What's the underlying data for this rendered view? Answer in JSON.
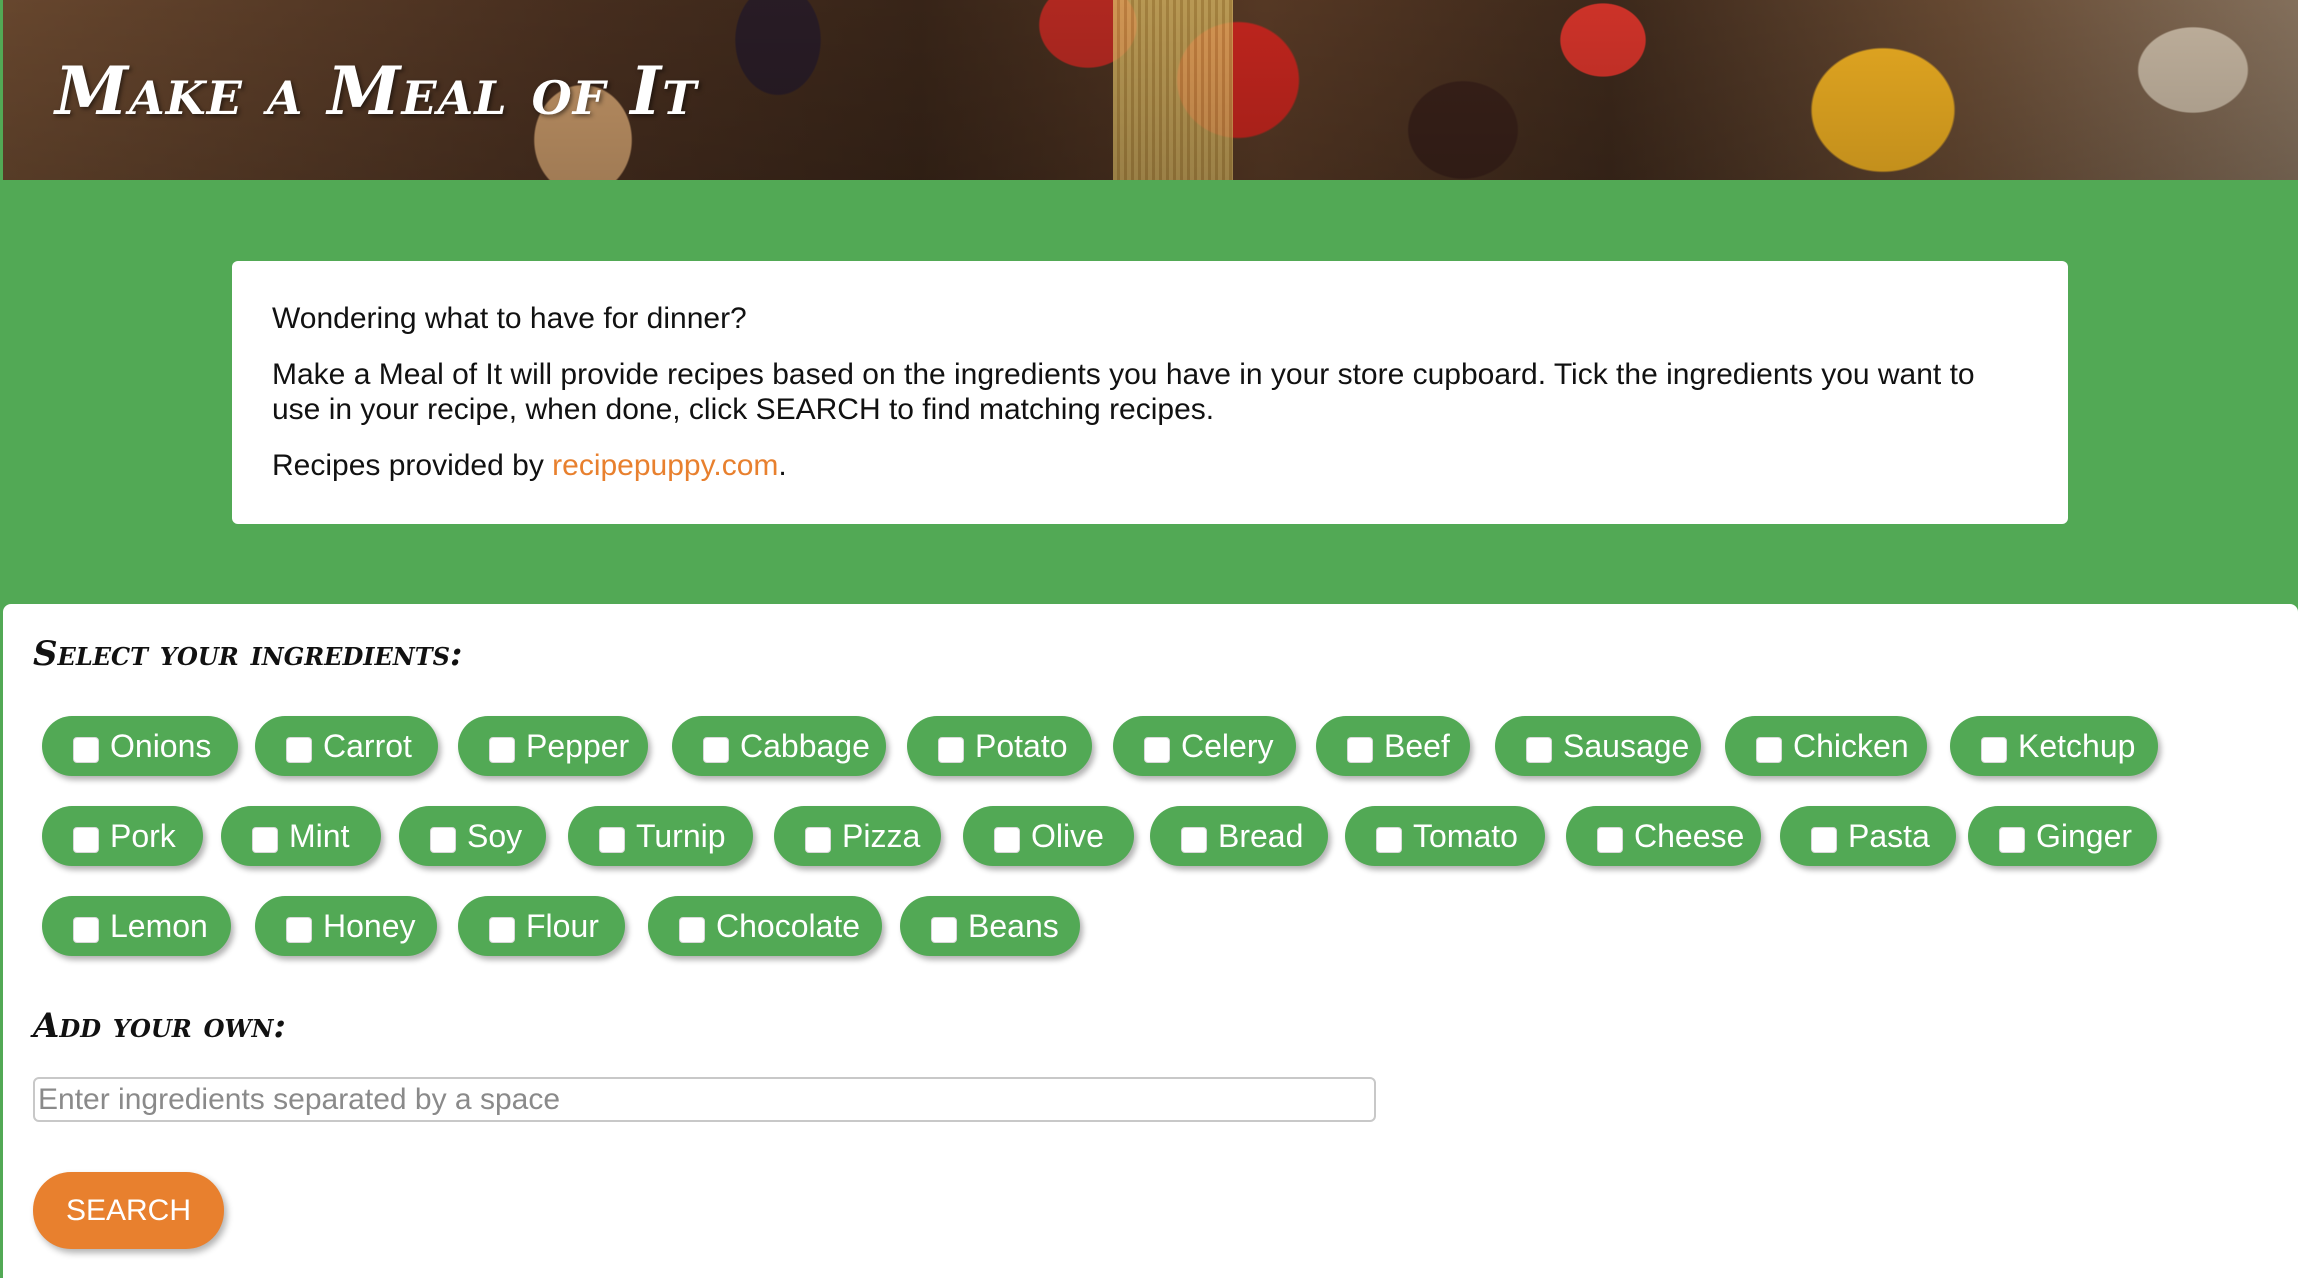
{
  "header": {
    "title": "Make a Meal of It"
  },
  "intro": {
    "question": "Wondering what to have for dinner?",
    "description": "Make a Meal of It will provide recipes based on the ingredients you have in your store cupboard. Tick the ingredients you want to use in your recipe, when done, click SEARCH to find matching recipes.",
    "credit_prefix": "Recipes provided by ",
    "credit_link": "recipepuppy.com",
    "credit_suffix": "."
  },
  "ingredients": {
    "heading": "Select your ingredients:",
    "rows": [
      [
        "Onions",
        "Carrot",
        "Pepper",
        "Cabbage",
        "Potato",
        "Celery",
        "Beef",
        "Sausage",
        "Chicken",
        "Ketchup"
      ],
      [
        "Pork",
        "Mint",
        "Soy",
        "Turnip",
        "Pizza",
        "Olive",
        "Bread",
        "Tomato",
        "Cheese",
        "Pasta",
        "Ginger"
      ],
      [
        "Lemon",
        "Honey",
        "Flour",
        "Chocolate",
        "Beans"
      ]
    ]
  },
  "own": {
    "heading": "Add your own:",
    "placeholder": "Enter ingredients separated by a space",
    "value": ""
  },
  "search": {
    "label": "SEARCH"
  },
  "colors": {
    "brand_green": "#52a955",
    "accent_orange": "#e8802e"
  }
}
